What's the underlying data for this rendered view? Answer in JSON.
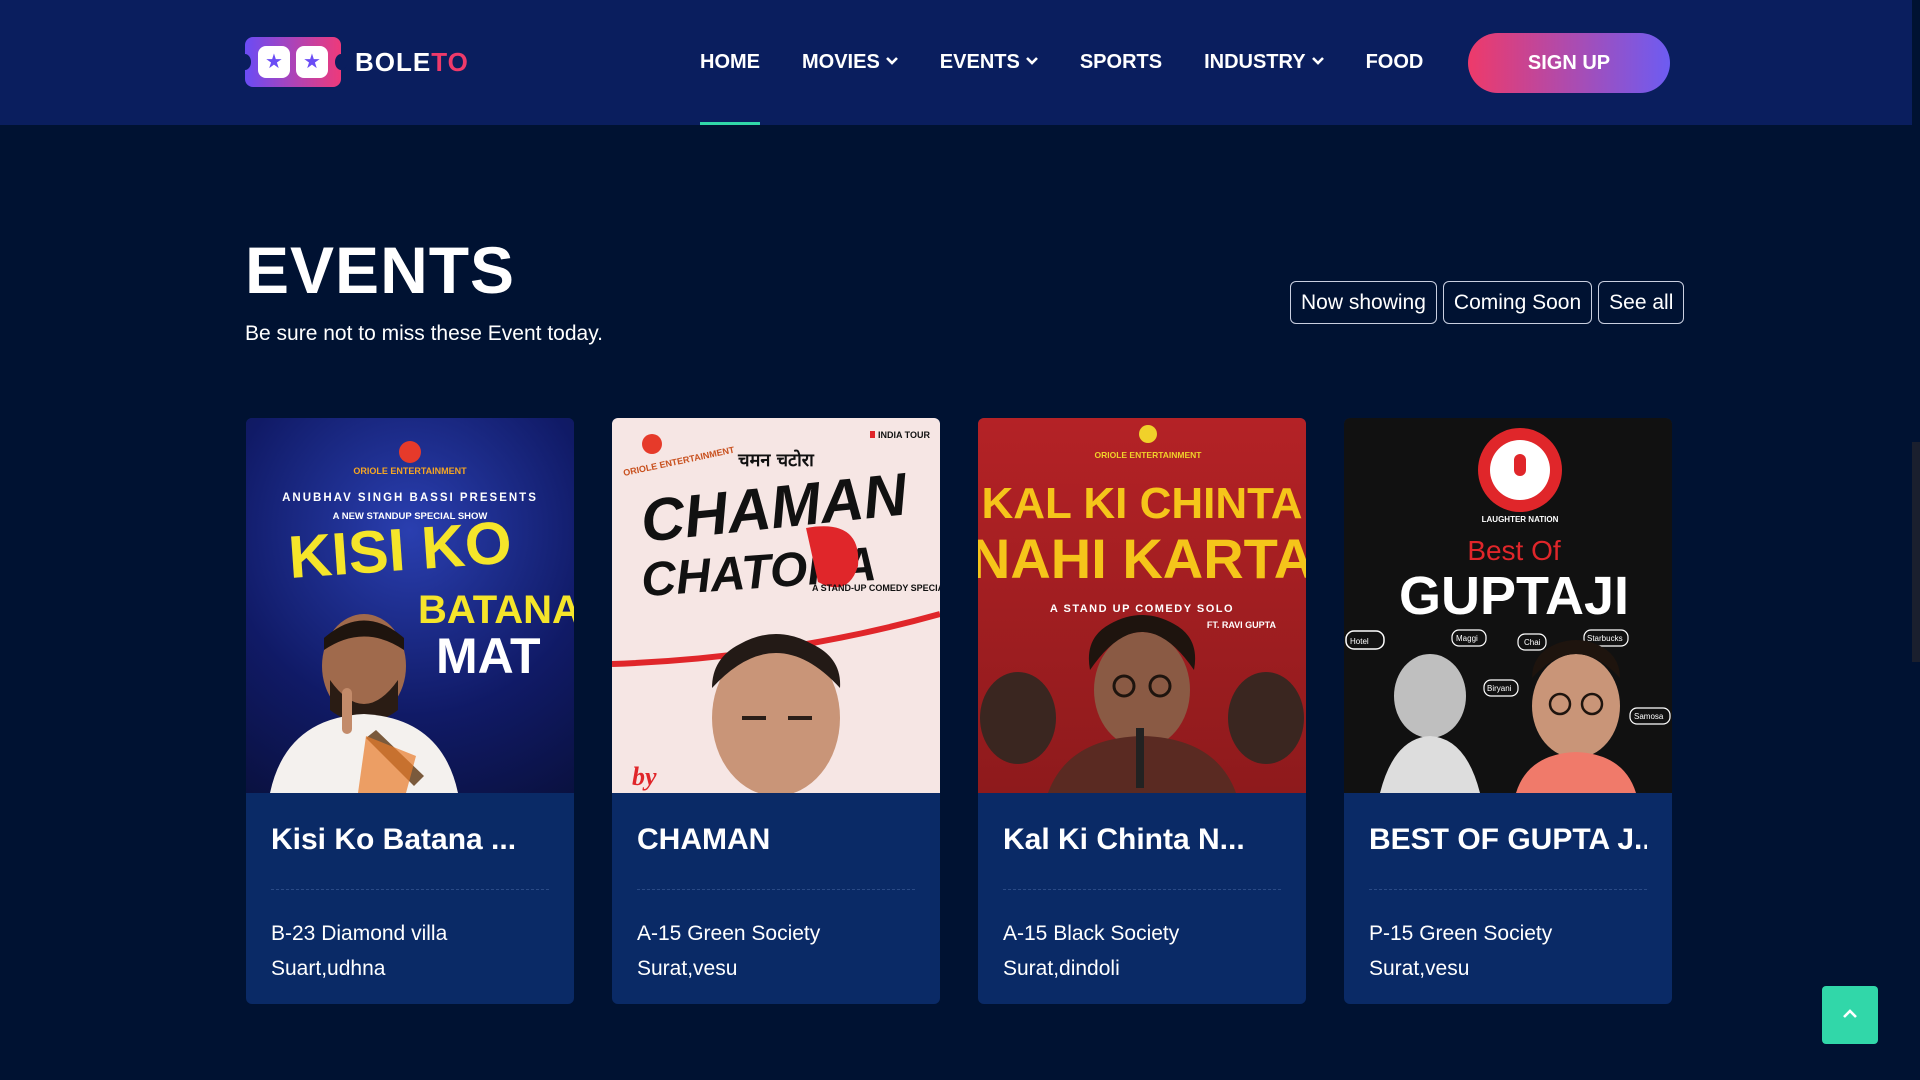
{
  "brand": {
    "name_part1": "BOLE",
    "name_part2": "TO"
  },
  "nav": {
    "items": [
      {
        "label": "HOME",
        "dropdown": false,
        "active": true
      },
      {
        "label": "MOVIES",
        "dropdown": true,
        "active": false
      },
      {
        "label": "EVENTS",
        "dropdown": true,
        "active": false
      },
      {
        "label": "SPORTS",
        "dropdown": false,
        "active": false
      },
      {
        "label": "INDUSTRY",
        "dropdown": true,
        "active": false
      },
      {
        "label": "FOOD",
        "dropdown": false,
        "active": false
      }
    ],
    "signup_label": "SIGN UP"
  },
  "section": {
    "title": "EVENTS",
    "subtitle": "Be sure not to miss these Event today.",
    "filters": [
      "Now showing",
      "Coming Soon",
      "See all"
    ]
  },
  "cards": [
    {
      "title": "Kisi Ko Batana ...",
      "address_line1": "B-23 Diamond villa",
      "address_line2": "Suart,udhna",
      "poster": {
        "top_text": "ANUBHAV SINGH BASSI PRESENTS",
        "sub_text": "A NEW STANDUP SPECIAL SHOW",
        "line1": "KISI KO",
        "line2": "BATANA",
        "line3": "MAT",
        "brand": "ORIOLE ENTERTAINMENT"
      }
    },
    {
      "title": "CHAMAN",
      "address_line1": "A-15 Green Society",
      "address_line2": "Surat,vesu",
      "poster": {
        "tag": "INDIA TOUR",
        "hindi": "चमन चटोरा",
        "line1": "CHAMAN",
        "line2": "CHATORA",
        "sub_text": "A STAND-UP COMEDY SPECIAL",
        "brand": "ORIOLE ENTERTAINMENT",
        "by": "by"
      }
    },
    {
      "title": "Kal Ki Chinta N...",
      "address_line1": "A-15 Black Society",
      "address_line2": "Surat,dindoli",
      "poster": {
        "line1": "KAL KI CHINTA",
        "line2": "NAHI KARTA",
        "sub_text": "A STAND UP COMEDY SOLO",
        "ft": "FT. RAVI GUPTA",
        "brand": "ORIOLE ENTERTAINMENT"
      }
    },
    {
      "title": "BEST OF GUPTA J...",
      "address_line1": "P-15 Green Society",
      "address_line2": "Surat,vesu",
      "poster": {
        "badge": "LAUGHTER NATION",
        "line1": "Best Of",
        "line2": "GUPTAJI",
        "bubble1": "Hotel",
        "bubble2": "Maggi",
        "bubble3": "Chai",
        "bubble4": "Starbucks",
        "bubble5": "Samosa",
        "bubble6": "Biryani"
      }
    }
  ],
  "colors": {
    "background": "#001232",
    "header": "#0a1e5e",
    "card": "#0a2a66",
    "accent": "#31d7a9",
    "gradient_start": "#ee3a6a",
    "gradient_end": "#6d5cf2"
  },
  "icons": {
    "scroll_top": "chevron-up-icon",
    "dropdown": "chevron-down-icon"
  }
}
